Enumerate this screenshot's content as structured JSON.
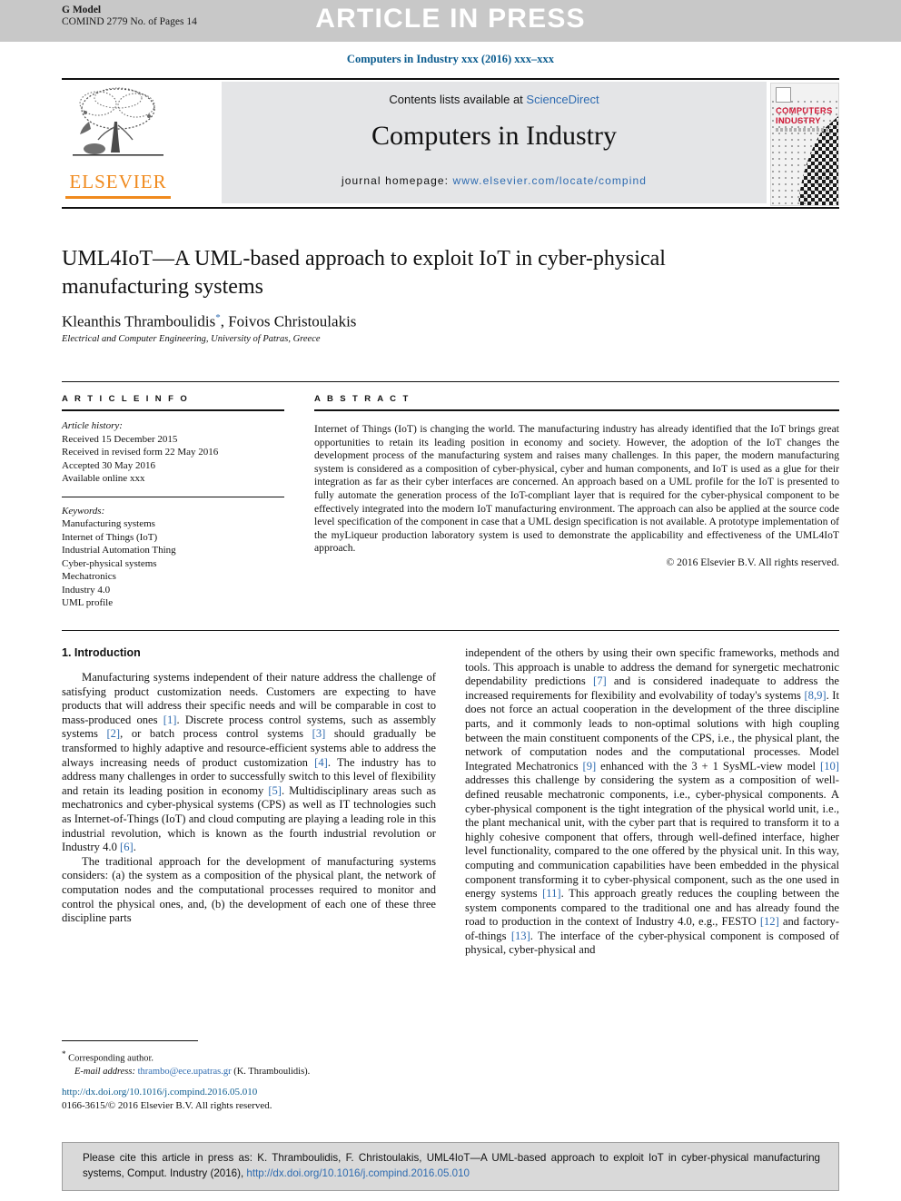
{
  "header": {
    "g_model": "G Model",
    "g_model_sub": "COMIND 2779 No. of Pages 14",
    "article_in_press": "ARTICLE IN PRESS",
    "running_head": "Computers in Industry xxx (2016) xxx–xxx"
  },
  "masthead": {
    "contents_prefix": "Contents lists available at ",
    "sciencedirect": "ScienceDirect",
    "journal_title": "Computers in Industry",
    "homepage_label": "journal homepage: ",
    "homepage_url": "www.elsevier.com/locate/compind",
    "publisher": "ELSEVIER",
    "cover_title_line1": "COMPUTERS IN",
    "cover_title_line2": "INDUSTRY"
  },
  "article": {
    "title": "UML4IoT—A UML-based approach to exploit IoT in cyber-physical manufacturing systems",
    "authors": "Kleanthis Thramboulidis",
    "authors_tail": ", Foivos Christoulakis",
    "corresponding_marker": "*",
    "affiliation": "Electrical and Computer Engineering, University of Patras, Greece"
  },
  "info": {
    "heading": "A R T I C L E   I N F O",
    "history_label": "Article history:",
    "history": [
      "Received 15 December 2015",
      "Received in revised form 22 May 2016",
      "Accepted 30 May 2016",
      "Available online xxx"
    ],
    "keywords_label": "Keywords:",
    "keywords": [
      "Manufacturing systems",
      "Internet of Things (IoT)",
      "Industrial Automation Thing",
      "Cyber-physical systems",
      "Mechatronics",
      "Industry 4.0",
      "UML profile"
    ]
  },
  "abstract": {
    "heading": "A B S T R A C T",
    "text": "Internet of Things (IoT) is changing the world. The manufacturing industry has already identified that the IoT brings great opportunities to retain its leading position in economy and society. However, the adoption of the IoT changes the development process of the manufacturing system and raises many challenges. In this paper, the modern manufacturing system is considered as a composition of cyber-physical, cyber and human components, and IoT is used as a glue for their integration as far as their cyber interfaces are concerned. An approach based on a UML profile for the IoT is presented to fully automate the generation process of the IoT-compliant layer that is required for the cyber-physical component to be effectively integrated into the modern IoT manufacturing environment. The approach can also be applied at the source code level specification of the component in case that a UML design specification is not available. A prototype implementation of the myLiqueur production laboratory system is used to demonstrate the applicability and effectiveness of the UML4IoT approach.",
    "copyright": "© 2016 Elsevier B.V. All rights reserved."
  },
  "body": {
    "section_heading": "1. Introduction",
    "left_paragraphs": [
      {
        "segments": [
          {
            "t": "Manufacturing systems independent of their nature address the challenge of satisfying product customization needs. Customers are expecting to have products that will address their specific needs and will be comparable in cost to mass-produced ones "
          },
          {
            "t": "[1]",
            "cite": true
          },
          {
            "t": ". Discrete process control systems, such as assembly systems "
          },
          {
            "t": "[2]",
            "cite": true
          },
          {
            "t": ", or batch process control systems "
          },
          {
            "t": "[3]",
            "cite": true
          },
          {
            "t": " should gradually be transformed to highly adaptive and resource-efficient systems able to address the always increasing needs of product customization "
          },
          {
            "t": "[4]",
            "cite": true
          },
          {
            "t": ". The industry has to address many challenges in order to successfully switch to this level of flexibility and retain its leading position in economy "
          },
          {
            "t": "[5]",
            "cite": true
          },
          {
            "t": ". Multidisciplinary areas such as mechatronics and cyber-physical systems (CPS) as well as IT technologies such as Internet-of-Things (IoT) and cloud computing are playing a leading role in this industrial revolution, which is known as the fourth industrial revolution or Industry 4.0 "
          },
          {
            "t": "[6]",
            "cite": true
          },
          {
            "t": "."
          }
        ]
      },
      {
        "segments": [
          {
            "t": "The traditional approach for the development of manufacturing systems considers: (a) the system as a composition of the physical plant, the network of computation nodes and the computational processes required to monitor and control the physical ones, and, (b) the development of each one of these three discipline parts"
          }
        ]
      }
    ],
    "right_paragraphs": [
      {
        "noindent": true,
        "segments": [
          {
            "t": "independent of the others by using their own specific frameworks, methods and tools. This approach is unable to address the demand for synergetic mechatronic dependability predictions "
          },
          {
            "t": "[7]",
            "cite": true
          },
          {
            "t": " and is considered inadequate to address the increased requirements for flexibility and evolvability of today's systems "
          },
          {
            "t": "[8,9]",
            "cite": true
          },
          {
            "t": ". It does not force an actual cooperation in the development of the three discipline parts, and it commonly leads to non-optimal solutions with high coupling between the main constituent components of the CPS, i.e., the physical plant, the network of computation nodes and the computational processes. Model Integrated Mechatronics "
          },
          {
            "t": "[9]",
            "cite": true
          },
          {
            "t": " enhanced with the 3 + 1 SysML-view model "
          },
          {
            "t": "[10]",
            "cite": true
          },
          {
            "t": " addresses this challenge by considering the system as a composition of well-defined reusable mechatronic components, i.e., cyber-physical components. A cyber-physical component is the tight integration of the physical world unit, i.e., the plant mechanical unit, with the cyber part that is required to transform it to a highly cohesive component that offers, through well-defined interface, higher level functionality, compared to the one offered by the physical unit. In this way, computing and communication capabilities have been embedded in the physical component transforming it to cyber-physical component, such as the one used in energy systems "
          },
          {
            "t": "[11]",
            "cite": true
          },
          {
            "t": ". This approach greatly reduces the coupling between the system components compared to the traditional one and has already found the road to production in the context of Industry 4.0, e.g., FESTO "
          },
          {
            "t": "[12]",
            "cite": true
          },
          {
            "t": " and factory-of-things "
          },
          {
            "t": "[13]",
            "cite": true
          },
          {
            "t": ". The interface of the cyber-physical component is composed of physical, cyber-physical and"
          }
        ]
      }
    ]
  },
  "footnote": {
    "marker": "*",
    "corresponding": "Corresponding author.",
    "email_label": "E-mail address:",
    "email": "thrambo@ece.upatras.gr",
    "email_owner": "(K. Thramboulidis)."
  },
  "imprint": {
    "doi_url": "http://dx.doi.org/10.1016/j.compind.2016.05.010",
    "issn_line": "0166-3615/© 2016 Elsevier B.V. All rights reserved."
  },
  "cite_box": {
    "text": "Please cite this article in press as: K. Thramboulidis, F. Christoulakis, UML4IoT—A UML-based approach to exploit IoT in cyber-physical manufacturing systems, Comput. Industry (2016), ",
    "doi": "http://dx.doi.org/10.1016/j.compind.2016.05.010"
  }
}
